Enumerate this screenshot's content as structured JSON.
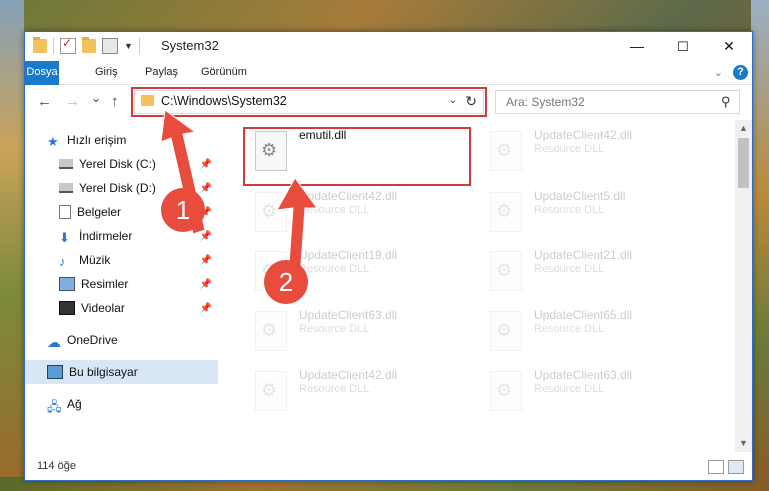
{
  "window": {
    "title": "System32",
    "controls": {
      "minimize": "—",
      "maximize": "☐",
      "close": "✕"
    }
  },
  "ribbon": {
    "tabs": [
      "Dosya",
      "Giriş",
      "Paylaş",
      "Görünüm"
    ]
  },
  "nav": {
    "back": "←",
    "forward": "→",
    "recent": "⌄",
    "up": "↑",
    "address": "C:\\Windows\\System32",
    "search_placeholder": "Ara: System32"
  },
  "sidebar": {
    "items": [
      {
        "label": "Hızlı erişim",
        "pinned": false
      },
      {
        "label": "Yerel Disk (C:)",
        "pinned": true
      },
      {
        "label": "Yerel Disk (D:)",
        "pinned": true
      },
      {
        "label": "Belgeler",
        "pinned": true
      },
      {
        "label": "İndirmeler",
        "pinned": true
      },
      {
        "label": "Müzik",
        "pinned": true
      },
      {
        "label": "Resimler",
        "pinned": true
      },
      {
        "label": "Videolar",
        "pinned": true
      },
      {
        "label": "OneDrive",
        "pinned": false
      },
      {
        "label": "Bu bilgisayar",
        "pinned": false,
        "selected": true
      },
      {
        "label": "Ağ",
        "pinned": false
      }
    ]
  },
  "files": [
    {
      "name": "emutil.dll",
      "type": ""
    },
    {
      "name": "UpdateClient42.dll",
      "type": "Resource DLL"
    },
    {
      "name": "UpdateClient42.dll",
      "type": "Resource DLL"
    },
    {
      "name": "UpdateClient5.dll",
      "type": "Resource DLL"
    },
    {
      "name": "UpdateClient19.dll",
      "type": "Resource DLL"
    },
    {
      "name": "UpdateClient21.dll",
      "type": "Resource DLL"
    },
    {
      "name": "UpdateClient63.dll",
      "type": "Resource DLL"
    },
    {
      "name": "UpdateClient65.dll",
      "type": "Resource DLL"
    },
    {
      "name": "UpdateClient42.dll",
      "type": "Resource DLL"
    },
    {
      "name": "UpdateClient63.dll",
      "type": "Resource DLL"
    }
  ],
  "status": {
    "item_count": "114 öğe"
  },
  "annotations": {
    "badge1": "1",
    "badge2": "2",
    "color": "#e74c3c"
  }
}
